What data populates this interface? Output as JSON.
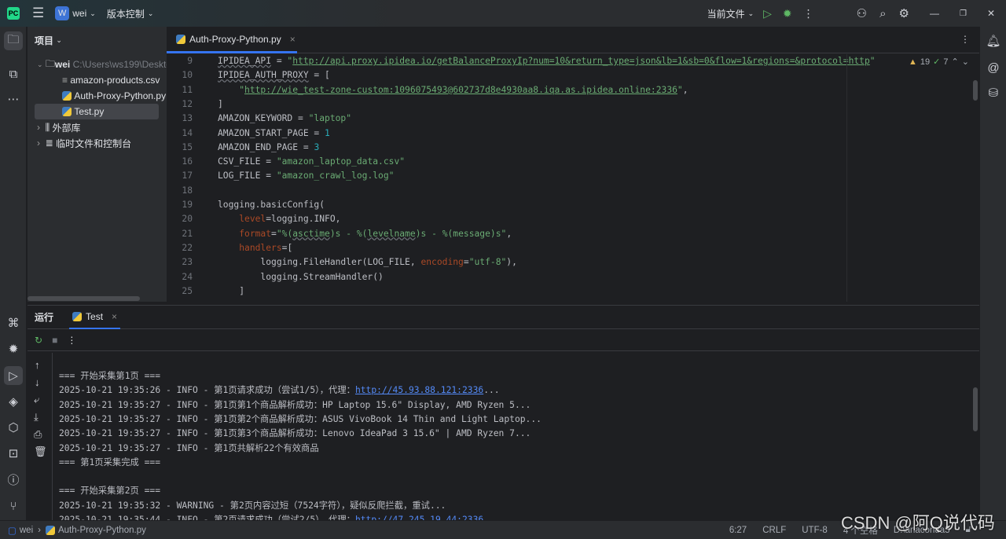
{
  "titlebar": {
    "project_badge": "W",
    "project_name": "wei",
    "vcs": "版本控制",
    "run_config": "当前文件"
  },
  "project_panel": {
    "title": "项目",
    "root": {
      "name": "wei",
      "path": "C:\\Users\\ws199\\Deskto"
    },
    "files": [
      "amazon-products.csv",
      "Auth-Proxy-Python.py",
      "Test.py"
    ],
    "external": "外部库",
    "scratches": "临时文件和控制台"
  },
  "editor": {
    "tab": "Auth-Proxy-Python.py",
    "warnings": "19",
    "checks": "7",
    "lines": [
      {
        "n": "9",
        "t": [
          [
            "IPIDEA_API",
            "id ul"
          ],
          [
            " = ",
            "id"
          ],
          [
            "\"",
            "str"
          ],
          [
            "http://api.proxy.ipidea.io/getBalanceProxyIp?num=10&return_type=json&lb=1&sb=0&flow=1&regions=&protocol=http",
            "url"
          ],
          [
            "\"",
            "str"
          ]
        ]
      },
      {
        "n": "10",
        "t": [
          [
            "IPIDEA_AUTH_PROXY",
            "id ul"
          ],
          [
            " = [",
            "id"
          ]
        ]
      },
      {
        "n": "11",
        "t": [
          [
            "    \"",
            "str"
          ],
          [
            "http://wie_test-zone-custom:1096075493@602737d8e4930aa8.iqa.as.ipidea.online:2336",
            "url"
          ],
          [
            "\"",
            "str"
          ],
          [
            ",",
            "id"
          ]
        ]
      },
      {
        "n": "12",
        "t": [
          [
            "]",
            "id"
          ]
        ]
      },
      {
        "n": "13",
        "t": [
          [
            "AMAZON_KEYWORD = ",
            "id"
          ],
          [
            "\"laptop\"",
            "str"
          ]
        ]
      },
      {
        "n": "14",
        "t": [
          [
            "AMAZON_START_PAGE = ",
            "id"
          ],
          [
            "1",
            "num"
          ]
        ]
      },
      {
        "n": "15",
        "t": [
          [
            "AMAZON_END_PAGE = ",
            "id"
          ],
          [
            "3",
            "num"
          ]
        ]
      },
      {
        "n": "16",
        "t": [
          [
            "CSV_FILE = ",
            "id"
          ],
          [
            "\"amazon_laptop_data.csv\"",
            "str"
          ]
        ]
      },
      {
        "n": "17",
        "t": [
          [
            "LOG_FILE = ",
            "id"
          ],
          [
            "\"amazon_crawl_log.log\"",
            "str"
          ]
        ]
      },
      {
        "n": "18",
        "t": []
      },
      {
        "n": "19",
        "t": [
          [
            "logging.basicConfig(",
            "id"
          ]
        ]
      },
      {
        "n": "20",
        "t": [
          [
            "    ",
            "id"
          ],
          [
            "level",
            "par"
          ],
          [
            "=logging.INFO,",
            "id"
          ]
        ]
      },
      {
        "n": "21",
        "t": [
          [
            "    ",
            "id"
          ],
          [
            "format",
            "par"
          ],
          [
            "=",
            "id"
          ],
          [
            "\"%(",
            "str"
          ],
          [
            "asctime",
            "str ul"
          ],
          [
            ")s - %(",
            "str"
          ],
          [
            "levelname",
            "str ul"
          ],
          [
            ")s - %(message)s\"",
            "str"
          ],
          [
            ",",
            "id"
          ]
        ]
      },
      {
        "n": "22",
        "t": [
          [
            "    ",
            "id"
          ],
          [
            "handlers",
            "par"
          ],
          [
            "=[",
            "id"
          ]
        ]
      },
      {
        "n": "23",
        "t": [
          [
            "        logging.FileHandler(LOG_FILE, ",
            "id"
          ],
          [
            "encoding",
            "par"
          ],
          [
            "=",
            "id"
          ],
          [
            "\"utf-8\"",
            "str"
          ],
          [
            "),",
            "id"
          ]
        ]
      },
      {
        "n": "24",
        "t": [
          [
            "        logging.StreamHandler()",
            "id"
          ]
        ]
      },
      {
        "n": "25",
        "t": [
          [
            "    ]",
            "id"
          ]
        ]
      }
    ]
  },
  "run_panel": {
    "title": "运行",
    "tab": "Test",
    "lines": [
      [
        [
          "=== 开始采集第1页 ===",
          ""
        ]
      ],
      [
        [
          "2025-10-21 19:35:26 - INFO - 第1页请求成功（尝试1/5），代理：",
          ""
        ],
        [
          "http://45.93.88.121:2336",
          "link"
        ],
        [
          "...",
          ""
        ]
      ],
      [
        [
          "2025-10-21 19:35:27 - INFO - 第1页第1个商品解析成功：HP Laptop 15.6\" Display, AMD Ryzen 5...",
          ""
        ]
      ],
      [
        [
          "2025-10-21 19:35:27 - INFO - 第1页第2个商品解析成功：ASUS VivoBook 14 Thin and Light Laptop...",
          ""
        ]
      ],
      [
        [
          "2025-10-21 19:35:27 - INFO - 第1页第3个商品解析成功：Lenovo IdeaPad 3 15.6\" | AMD Ryzen 7...",
          ""
        ]
      ],
      [
        [
          "2025-10-21 19:35:27 - INFO - 第1页共解析22个有效商品",
          ""
        ]
      ],
      [
        [
          "=== 第1页采集完成 ===",
          ""
        ]
      ],
      [
        [
          "",
          ""
        ]
      ],
      [
        [
          "=== 开始采集第2页 ===",
          ""
        ]
      ],
      [
        [
          "2025-10-21 19:35:32 - WARNING - 第2页内容过短（7524字符），疑似反爬拦截，重试...",
          ""
        ]
      ],
      [
        [
          "2025-10-21 19:35:44 - INFO - 第2页请求成功（尝试2/5），代理：",
          ""
        ],
        [
          "http://47.245.19.44:2336",
          "link"
        ]
      ]
    ]
  },
  "statusbar": {
    "breadcrumb_root": "wei",
    "breadcrumb_file": "Auth-Proxy-Python.py",
    "position": "6:27",
    "line_sep": "CRLF",
    "encoding": "UTF-8",
    "indent": "4 个空格",
    "interpreter": "D:\\anaconda3"
  },
  "watermark": "CSDN @阿Q说代码"
}
